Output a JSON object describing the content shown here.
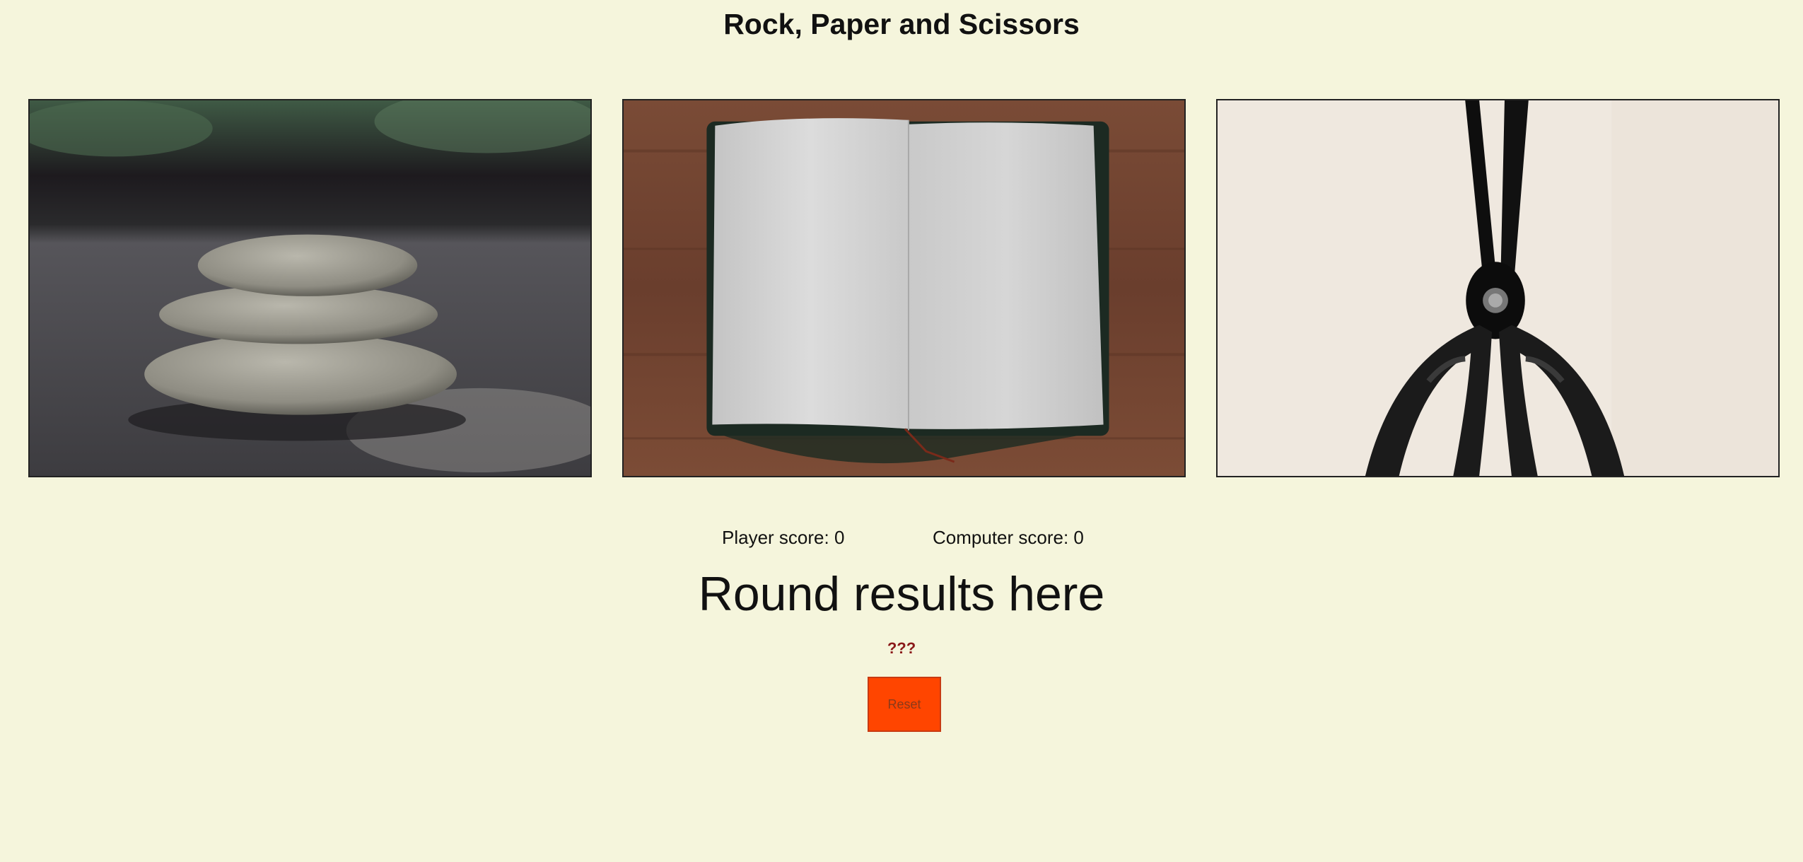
{
  "page": {
    "title": "Rock, Paper and Scissors"
  },
  "choices": [
    {
      "id": "rock",
      "icon": "rock-stack-photo"
    },
    {
      "id": "paper",
      "icon": "open-notebook-photo"
    },
    {
      "id": "scissors",
      "icon": "scissors-photo"
    }
  ],
  "scores": {
    "player_label": "Player score: 0",
    "computer_label": "Computer score: 0"
  },
  "round": {
    "result_text": "Round results here",
    "detail_text": "???"
  },
  "controls": {
    "reset_label": "Reset"
  },
  "colors": {
    "background": "#f5f5dc",
    "reset_button": "#ff4500",
    "detail_text": "#8b1a1a"
  }
}
